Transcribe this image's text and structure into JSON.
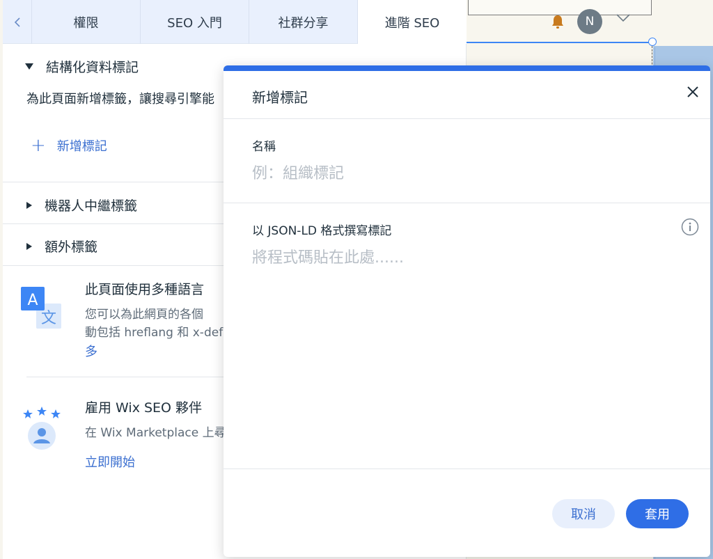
{
  "header": {
    "avatar_letter": "N",
    "tabs": [
      {
        "label": "權限"
      },
      {
        "label": "SEO 入門"
      },
      {
        "label": "社群分享"
      },
      {
        "label": "進階 SEO"
      }
    ]
  },
  "panel": {
    "structured_data": {
      "title": "結構化資料標記",
      "description": "為此頁面新增標籤，讓搜尋引擎能",
      "add_label": "新增標記"
    },
    "robots": {
      "title": "機器人中繼標籤"
    },
    "additional": {
      "title": "額外標籤"
    },
    "multilingual": {
      "title": "此頁面使用多種語言",
      "line1": "您可以為此網頁的各個",
      "line2": "動包括 hreflang 和 x-def",
      "line3": "多"
    },
    "hire": {
      "title": "雇用 Wix SEO 夥伴",
      "text": "在 Wix Marketplace 上尋",
      "link": "立即開始"
    }
  },
  "dialog": {
    "title": "新增標記",
    "name_label": "名稱",
    "name_placeholder": "例：組織標記",
    "markup_label": "以 JSON-LD 格式撰寫標記",
    "markup_placeholder": "將程式碼貼在此處......",
    "cancel_label": "取消",
    "apply_label": "套用"
  },
  "colors": {
    "accent": "#2f6ee6",
    "link": "#3b6fd0",
    "tab_bg": "#e9f0fd"
  }
}
